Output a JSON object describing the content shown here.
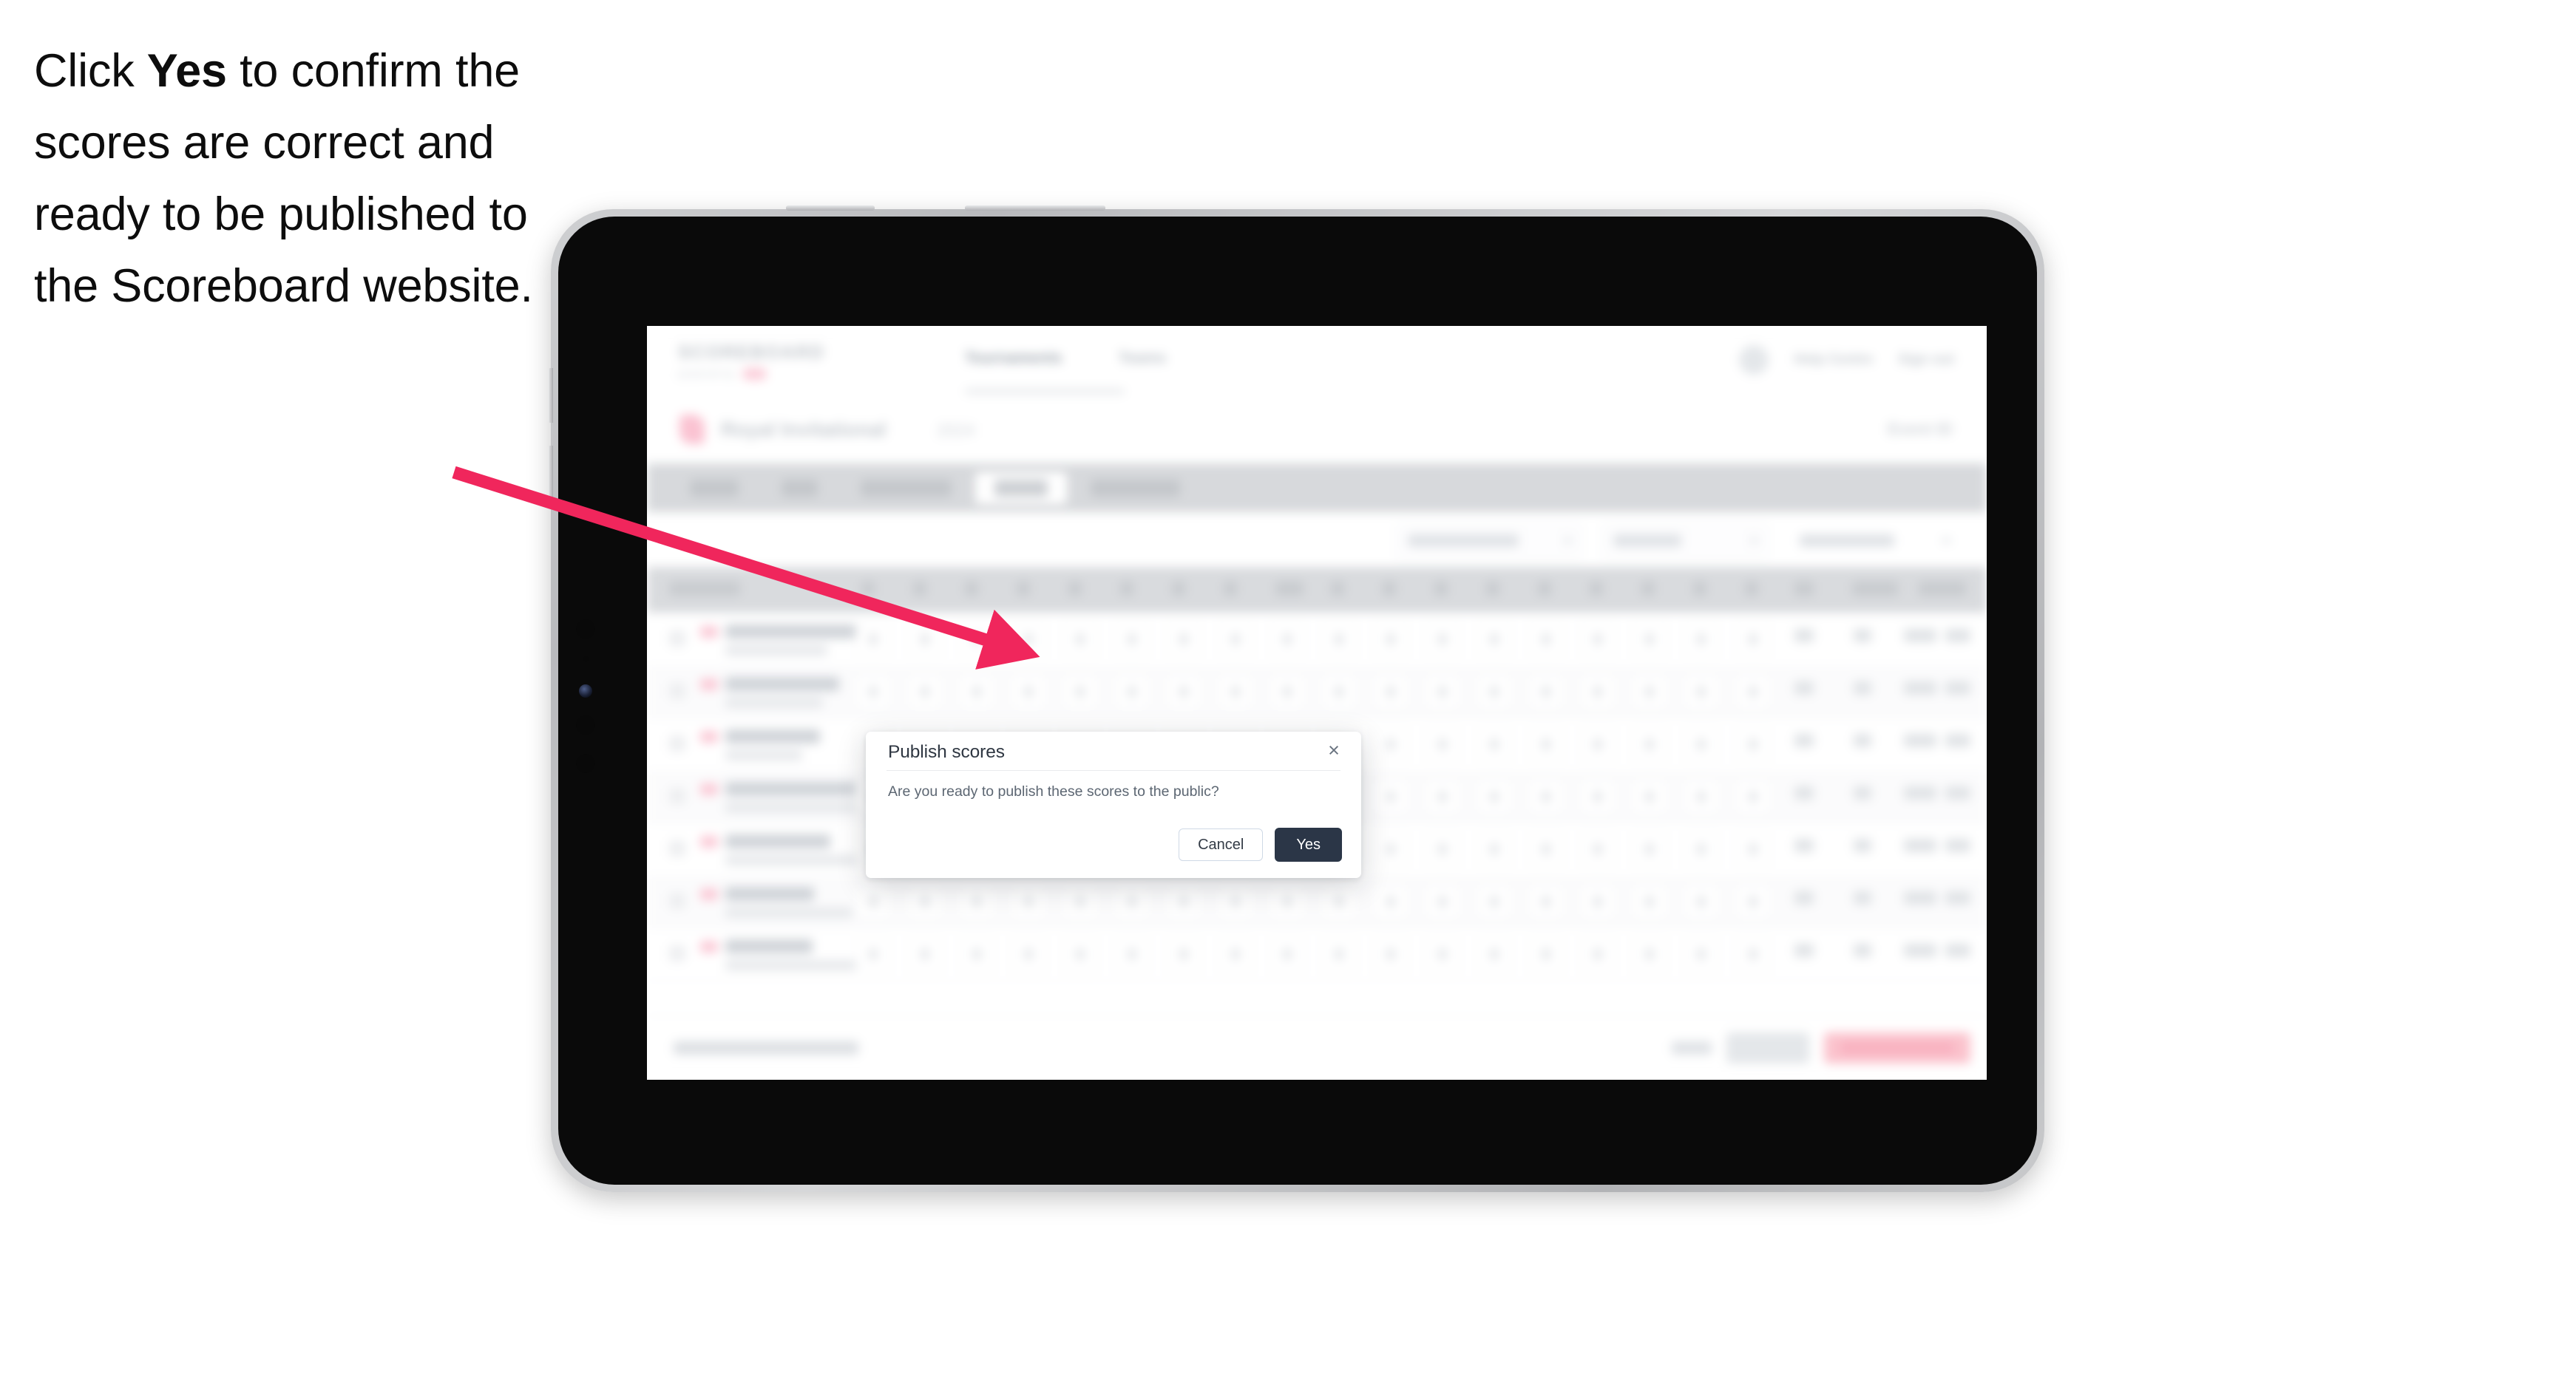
{
  "instruction": {
    "before": "Click ",
    "emphasis": "Yes",
    "after": " to confirm the scores are correct and ready to be published to the Scoreboard website."
  },
  "annotation": {
    "arrow_color": "#f0265c",
    "arrow_name": "pointer-arrow"
  },
  "device": {
    "name": "tablet-mockup",
    "bezel_color": "#c6c7ca",
    "screen_color": "#0a0a0a"
  },
  "app": {
    "navbar": {
      "brand": "SCOREBOARD",
      "brand_sub": "powered by",
      "brand_pill": "",
      "links": [
        {
          "label": "Tournaments"
        },
        {
          "label": "Teams"
        }
      ],
      "right": [
        {
          "label": "avatar",
          "name": "avatar"
        },
        {
          "label": "Help Centre"
        },
        {
          "label": "Sign out"
        }
      ]
    },
    "event": {
      "icon": "event-icon",
      "title": "Royal Invitational",
      "subtitle": "2024",
      "right_label": "Event ID"
    },
    "tabs": [
      {
        "label": "Details",
        "active": false
      },
      {
        "label": "Draw",
        "active": false
      },
      {
        "label": "Games Table",
        "active": false
      },
      {
        "label": "Results",
        "active": true
      },
      {
        "label": "Leaderboard",
        "active": false
      }
    ],
    "filters": [
      {
        "label": "Filter by team"
      },
      {
        "label": "Round"
      },
      {
        "label": "Team only"
      }
    ],
    "table": {
      "columns": [
        "Player",
        "1",
        "2",
        "3",
        "4",
        "5",
        "6",
        "7",
        "8",
        "9",
        "10",
        "11",
        "12",
        "13",
        "14",
        "15",
        "16",
        "17",
        "18",
        "In",
        "Points",
        "Status"
      ],
      "rows": [
        {
          "player": "Marcus Tavares",
          "club": "Coastal Links"
        },
        {
          "player": "Ellen Rennie",
          "club": "Coastal Links"
        },
        {
          "player": "Constance Robertson",
          "club": ""
        },
        {
          "player": "Peter Westerman",
          "club": "Northlands Country Club"
        },
        {
          "player": "Oliver Grant",
          "club": "Northlands Country Club"
        },
        {
          "player": "Nora Kirk",
          "club": "Riverbend Golf Club"
        },
        {
          "player": "Erik Nolan",
          "club": "Riverbend Golf Club"
        }
      ]
    },
    "footer": {
      "note": "Scores provisional until published",
      "link": "Cancel",
      "secondary_button": "Save",
      "primary_button": "Publish to Scoreboard"
    }
  },
  "modal": {
    "name": "publish-scores-dialog",
    "title": "Publish scores",
    "message": "Are you ready to publish these scores to the public?",
    "close_icon": "×",
    "cancel_label": "Cancel",
    "confirm_label": "Yes",
    "confirm_bg": "#2b3647",
    "cancel_border": "#cfd9e6"
  }
}
